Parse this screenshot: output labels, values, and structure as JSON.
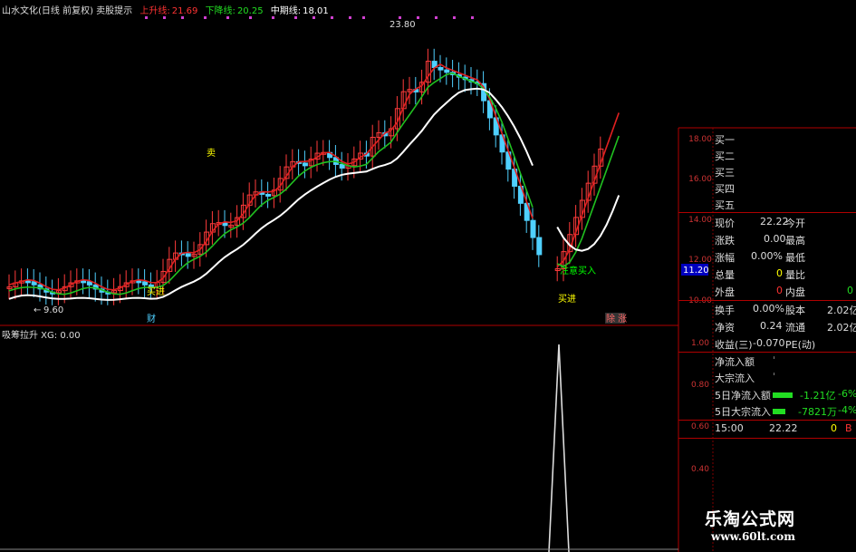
{
  "header": {
    "title": "山水文化(日线 前复权) 卖股提示",
    "up_label": "上升线:",
    "up_value": "21.69",
    "down_label": "下降线:",
    "down_value": "20.25",
    "mid_label": "中期线:",
    "mid_value": "18.01"
  },
  "main_chart": {
    "annotations": {
      "high_price": "23.80",
      "low_price": "9.60",
      "buy_signal": "买进",
      "watch_buy": "注意买入",
      "sell_signal": "卖",
      "buy_signal_2": "买进",
      "event_marker": "财",
      "event_marker_2": "除 涨"
    },
    "price_axis": [
      "18.00",
      "16.00",
      "14.00",
      "12.00",
      "10.00"
    ],
    "current_price_tag": "11.20"
  },
  "indicator": {
    "title": "吸筹拉升 XG: 0.00",
    "axis": [
      "1.00",
      "0.80",
      "0.60",
      "0.40"
    ]
  },
  "quote_panel": {
    "order_book": [
      {
        "label": "买一"
      },
      {
        "label": "买二"
      },
      {
        "label": "买三"
      },
      {
        "label": "买四"
      },
      {
        "label": "买五"
      }
    ],
    "current_price_label": "现价",
    "current_price_value": "22.22",
    "open_label": "今开",
    "change_label": "涨跌",
    "change_value": "0.00",
    "high_label": "最高",
    "change_pct_label": "涨幅",
    "change_pct_value": "0.00%",
    "low_label": "最低",
    "volume_label": "总量",
    "volume_value": "0",
    "volume_ratio_label": "量比",
    "outer_label": "外盘",
    "outer_value": "0",
    "inner_label": "内盘",
    "inner_value": "0",
    "turnover_label": "换手",
    "turnover_value": "0.00%",
    "capital_label": "股本",
    "capital_value": "2.02亿",
    "net_asset_label": "净资",
    "net_asset_value": "0.24",
    "float_label": "流通",
    "float_value": "2.02亿",
    "eps_label": "收益(三)",
    "eps_value": "-0.070",
    "pe_label": "PE(动)",
    "net_inflow_label": "净流入额",
    "big_inflow_label": "大宗流入",
    "net_inflow_5d_label": "5日净流入额",
    "net_inflow_5d_value": "-1.21亿",
    "net_inflow_5d_pct": "-6%",
    "big_inflow_5d_label": "5日大宗流入",
    "big_inflow_5d_value": "-7821万",
    "big_inflow_5d_pct": "-4%",
    "tick_time": "15:00",
    "tick_price": "22.22",
    "tick_volume": "0",
    "tick_flag": "B"
  },
  "watermark": {
    "site_name": "乐淘公式网",
    "site_url": "www.60lt.com"
  },
  "colors": {
    "up_candle": "#ff3b3b",
    "down_candle": "#4fd0ff",
    "ma_red": "#e02020",
    "ma_green": "#20c020",
    "ma_white": "#ffffff",
    "grid_red": "#a00000",
    "label_yellow": "#ffff00",
    "label_green": "#00ff00"
  }
}
